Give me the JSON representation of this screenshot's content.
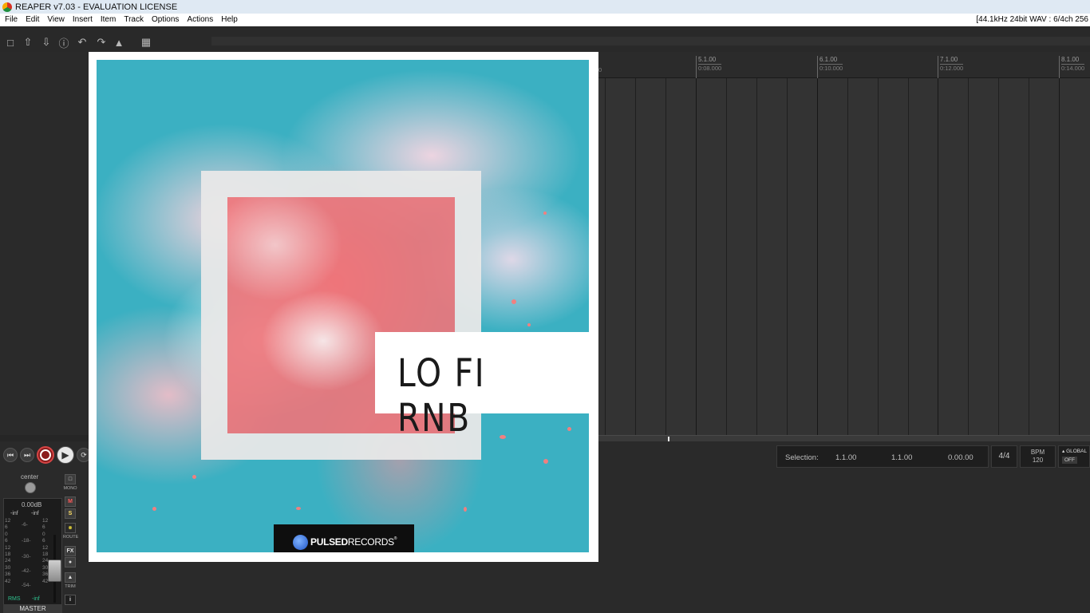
{
  "window": {
    "title": "REAPER v7.03 - EVALUATION LICENSE",
    "audio_status": "[44.1kHz 24bit WAV : 6/4ch 256"
  },
  "menu": [
    "File",
    "Edit",
    "View",
    "Insert",
    "Item",
    "Track",
    "Options",
    "Actions",
    "Help"
  ],
  "ruler": {
    "marks": [
      {
        "measure": "5.1.00",
        "time": "0:08.000"
      },
      {
        "measure": "6.1.00",
        "time": "0:10.000"
      },
      {
        "measure": "7.1.00",
        "time": "0:12.000"
      },
      {
        "measure": "8.1.00",
        "time": "0:14.000"
      }
    ],
    "partial_time": "0"
  },
  "transport": {
    "selection_label": "Selection:",
    "selection_start": "1.1.00",
    "selection_end": "1.1.00",
    "selection_length": "0.00.00",
    "time_signature": "4/4",
    "bpm_label": "BPM",
    "bpm_value": "120",
    "global_label": "GLOBAL",
    "global_state": "OFF"
  },
  "master": {
    "pan_label": "center",
    "volume": "0.00dB",
    "peak_left": "-inf",
    "peak_right": "-inf",
    "scale_left": [
      "12",
      "6",
      "0",
      "6",
      "12",
      "18",
      "24",
      "30",
      "36",
      "42"
    ],
    "scale_right": [
      "12",
      "6",
      "0",
      "6",
      "12",
      "18",
      "24",
      "30",
      "36",
      "42"
    ],
    "scale_mid": [
      "-6-",
      "-18-",
      "-30-",
      "-42-",
      "-54-"
    ],
    "rms_label": "RMS",
    "rms_value": "-inf",
    "name": "MASTER",
    "buttons": {
      "mono": "MONO",
      "mute": "M",
      "solo": "S",
      "route": "ROUTE",
      "fx": "FX",
      "trim": "TRIM",
      "info": "i"
    }
  },
  "album": {
    "title": "LO FI RNB",
    "label_part1": "PULSED",
    "label_part2": "RECORDS",
    "label_mark": "®"
  }
}
